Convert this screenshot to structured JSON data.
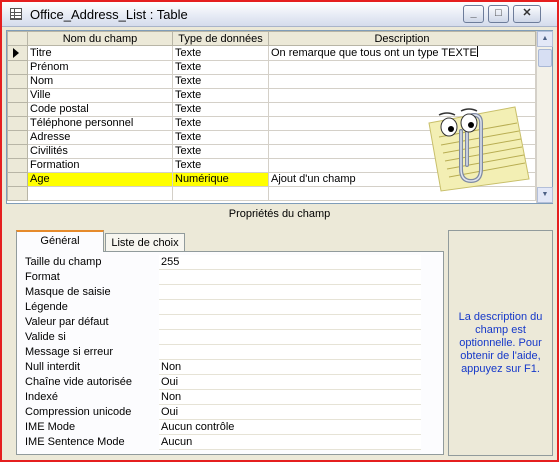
{
  "window": {
    "title": "Office_Address_List : Table",
    "minimize_glyph": "_",
    "maximize_glyph": "□",
    "close_glyph": "✕"
  },
  "grid": {
    "headers": [
      "Nom du champ",
      "Type de données",
      "Description"
    ],
    "rows": [
      {
        "name": "Titre",
        "type": "Texte",
        "description": "On remarque que tous ont un type TEXTE",
        "current": true
      },
      {
        "name": "Prénom",
        "type": "Texte",
        "description": ""
      },
      {
        "name": "Nom",
        "type": "Texte",
        "description": ""
      },
      {
        "name": "Ville",
        "type": "Texte",
        "description": ""
      },
      {
        "name": "Code postal",
        "type": "Texte",
        "description": ""
      },
      {
        "name": "Téléphone personnel",
        "type": "Texte",
        "description": ""
      },
      {
        "name": "Adresse",
        "type": "Texte",
        "description": ""
      },
      {
        "name": "Civilités",
        "type": "Texte",
        "description": ""
      },
      {
        "name": "Formation",
        "type": "Texte",
        "description": ""
      },
      {
        "name": "Age",
        "type": "Numérique",
        "description": "Ajout d'un champ",
        "highlight": "#ffff00"
      },
      {
        "name": "",
        "type": "",
        "description": ""
      }
    ]
  },
  "section_title": "Propriétés du champ",
  "tabs": [
    {
      "label": "Général",
      "active": true
    },
    {
      "label": "Liste de choix",
      "active": false
    }
  ],
  "properties": [
    {
      "label": "Taille du champ",
      "value": "255"
    },
    {
      "label": "Format",
      "value": ""
    },
    {
      "label": "Masque de saisie",
      "value": ""
    },
    {
      "label": "Légende",
      "value": ""
    },
    {
      "label": "Valeur par défaut",
      "value": ""
    },
    {
      "label": "Valide si",
      "value": ""
    },
    {
      "label": "Message si erreur",
      "value": ""
    },
    {
      "label": "Null interdit",
      "value": "Non"
    },
    {
      "label": "Chaîne vide autorisée",
      "value": "Oui"
    },
    {
      "label": "Indexé",
      "value": "Non"
    },
    {
      "label": "Compression unicode",
      "value": "Oui"
    },
    {
      "label": "IME Mode",
      "value": "Aucun contrôle"
    },
    {
      "label": "IME Sentence Mode",
      "value": "Aucun"
    }
  ],
  "help": {
    "text": "La description du champ est optionnelle. Pour obtenir de l'aide, appuyez sur F1."
  },
  "colors": {
    "highlight": "#ffff00",
    "help_text": "#1538c9",
    "window_border": "#e51f1f"
  },
  "icons": {
    "app": "table-icon",
    "row_selector": "current-row-arrow-icon",
    "assistant": "clippy-assistant-icon"
  }
}
